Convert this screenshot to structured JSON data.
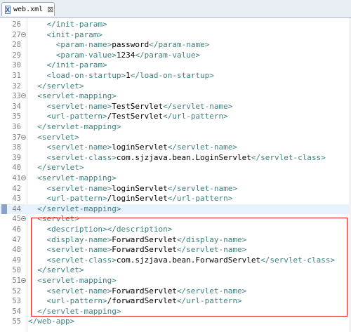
{
  "tab": {
    "label": "web.xml",
    "close": "⊠",
    "icon": "X"
  },
  "lines": [
    {
      "n": "26",
      "indent": "    ",
      "parts": [
        {
          "t": "tag",
          "v": "</init-param>"
        }
      ]
    },
    {
      "n": "27",
      "fold": true,
      "indent": "    ",
      "parts": [
        {
          "t": "tag",
          "v": "<init-param>"
        }
      ]
    },
    {
      "n": "28",
      "indent": "      ",
      "parts": [
        {
          "t": "tag",
          "v": "<param-name>"
        },
        {
          "t": "text",
          "v": "password"
        },
        {
          "t": "tag",
          "v": "</param-name>"
        }
      ]
    },
    {
      "n": "29",
      "indent": "      ",
      "parts": [
        {
          "t": "tag",
          "v": "<param-value>"
        },
        {
          "t": "text",
          "v": "1234"
        },
        {
          "t": "tag",
          "v": "</param-value>"
        }
      ]
    },
    {
      "n": "30",
      "indent": "    ",
      "parts": [
        {
          "t": "tag",
          "v": "</init-param>"
        }
      ]
    },
    {
      "n": "31",
      "indent": "    ",
      "parts": [
        {
          "t": "tag",
          "v": "<load-on-startup>"
        },
        {
          "t": "text",
          "v": "1"
        },
        {
          "t": "tag",
          "v": "</load-on-startup>"
        }
      ]
    },
    {
      "n": "32",
      "indent": "  ",
      "parts": [
        {
          "t": "tag",
          "v": "</servlet>"
        }
      ]
    },
    {
      "n": "33",
      "fold": true,
      "indent": "  ",
      "parts": [
        {
          "t": "tag",
          "v": "<servlet-mapping>"
        }
      ]
    },
    {
      "n": "34",
      "indent": "    ",
      "parts": [
        {
          "t": "tag",
          "v": "<servlet-name>"
        },
        {
          "t": "text",
          "v": "TestServlet"
        },
        {
          "t": "tag",
          "v": "</servlet-name>"
        }
      ]
    },
    {
      "n": "35",
      "indent": "    ",
      "parts": [
        {
          "t": "tag",
          "v": "<url-pattern>"
        },
        {
          "t": "text",
          "v": "/TestServlet"
        },
        {
          "t": "tag",
          "v": "</url-pattern>"
        }
      ]
    },
    {
      "n": "36",
      "indent": "  ",
      "parts": [
        {
          "t": "tag",
          "v": "</servlet-mapping>"
        }
      ]
    },
    {
      "n": "37",
      "fold": true,
      "indent": "  ",
      "parts": [
        {
          "t": "tag",
          "v": "<servlet>"
        }
      ]
    },
    {
      "n": "38",
      "indent": "    ",
      "parts": [
        {
          "t": "tag",
          "v": "<servlet-name>"
        },
        {
          "t": "text",
          "v": "loginServlet"
        },
        {
          "t": "tag",
          "v": "</servlet-name>"
        }
      ]
    },
    {
      "n": "39",
      "indent": "    ",
      "parts": [
        {
          "t": "tag",
          "v": "<servlet-class>"
        },
        {
          "t": "text",
          "v": "com.sjzjava.bean.LoginServlet"
        },
        {
          "t": "tag",
          "v": "</servlet-class>"
        }
      ]
    },
    {
      "n": "40",
      "indent": "  ",
      "parts": [
        {
          "t": "tag",
          "v": "</servlet>"
        }
      ]
    },
    {
      "n": "41",
      "fold": true,
      "indent": "  ",
      "parts": [
        {
          "t": "tag",
          "v": "<servlet-mapping>"
        }
      ]
    },
    {
      "n": "42",
      "indent": "    ",
      "parts": [
        {
          "t": "tag",
          "v": "<servlet-name>"
        },
        {
          "t": "text",
          "v": "loginServlet"
        },
        {
          "t": "tag",
          "v": "</servlet-name>"
        }
      ]
    },
    {
      "n": "43",
      "indent": "    ",
      "parts": [
        {
          "t": "tag",
          "v": "<url-pattern>"
        },
        {
          "t": "text",
          "v": "/loginServlet"
        },
        {
          "t": "tag",
          "v": "</url-pattern>"
        }
      ]
    },
    {
      "n": "44",
      "current": true,
      "indent": "  ",
      "parts": [
        {
          "t": "tag",
          "v": "</servlet-mapping>"
        }
      ]
    },
    {
      "n": "45",
      "fold": true,
      "indent": "  ",
      "parts": [
        {
          "t": "tag",
          "v": "<servlet>"
        }
      ]
    },
    {
      "n": "46",
      "indent": "    ",
      "parts": [
        {
          "t": "tag",
          "v": "<description>"
        },
        {
          "t": "tag",
          "v": "</description>"
        }
      ]
    },
    {
      "n": "47",
      "indent": "    ",
      "parts": [
        {
          "t": "tag",
          "v": "<display-name>"
        },
        {
          "t": "text",
          "v": "ForwardServlet"
        },
        {
          "t": "tag",
          "v": "</display-name>"
        }
      ]
    },
    {
      "n": "48",
      "indent": "    ",
      "parts": [
        {
          "t": "tag",
          "v": "<servlet-name>"
        },
        {
          "t": "text",
          "v": "ForwardServlet"
        },
        {
          "t": "tag",
          "v": "</servlet-name>"
        }
      ]
    },
    {
      "n": "49",
      "indent": "    ",
      "parts": [
        {
          "t": "tag",
          "v": "<servlet-class>"
        },
        {
          "t": "text",
          "v": "com.sjzjava.bean.ForwardServlet"
        },
        {
          "t": "tag",
          "v": "</servlet-class>"
        }
      ]
    },
    {
      "n": "50",
      "indent": "  ",
      "parts": [
        {
          "t": "tag",
          "v": "</servlet>"
        }
      ]
    },
    {
      "n": "51",
      "fold": true,
      "indent": "  ",
      "parts": [
        {
          "t": "tag",
          "v": "<servlet-mapping>"
        }
      ]
    },
    {
      "n": "52",
      "indent": "    ",
      "parts": [
        {
          "t": "tag",
          "v": "<servlet-name>"
        },
        {
          "t": "text",
          "v": "ForwardServlet"
        },
        {
          "t": "tag",
          "v": "</servlet-name>"
        }
      ]
    },
    {
      "n": "53",
      "indent": "    ",
      "parts": [
        {
          "t": "tag",
          "v": "<url-pattern>"
        },
        {
          "t": "text",
          "v": "/forwardServlet"
        },
        {
          "t": "tag",
          "v": "</url-pattern>"
        }
      ]
    },
    {
      "n": "54",
      "indent": "  ",
      "parts": [
        {
          "t": "tag",
          "v": "</servlet-mapping>"
        }
      ]
    },
    {
      "n": "55",
      "indent": "",
      "parts": [
        {
          "t": "tag",
          "v": "</web-app>"
        }
      ]
    }
  ],
  "colors": {
    "tag": "#3f7f7f",
    "text": "#000000",
    "highlight_box": "#e02020",
    "current_line": "#e8f2fe"
  }
}
